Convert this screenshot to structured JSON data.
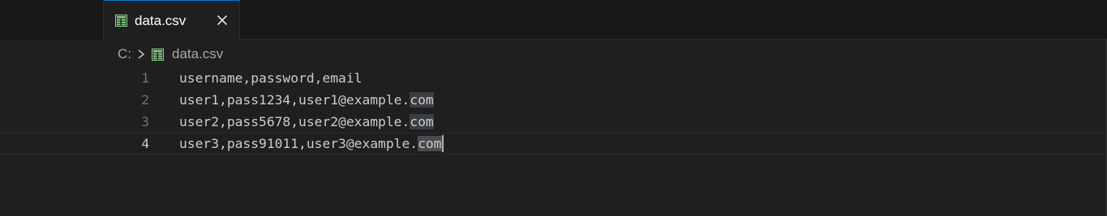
{
  "tab": {
    "label": "data.csv",
    "icon": "spreadsheet-icon",
    "close_icon": "close-icon"
  },
  "breadcrumb": {
    "drive": "C:",
    "separator_icon": "chevron-right-icon",
    "file": "data.csv"
  },
  "editor": {
    "lines": [
      {
        "number": "1",
        "text": "username,password,email",
        "match": ""
      },
      {
        "number": "2",
        "text": "user1,pass1234,user1@example.",
        "match": "com"
      },
      {
        "number": "3",
        "text": "user2,pass5678,user2@example.",
        "match": "com"
      },
      {
        "number": "4",
        "text": "user3,pass91011,user3@example.",
        "match": "com"
      }
    ],
    "current_line": "4"
  },
  "colors": {
    "accent": "#0078d4",
    "csv_icon": "#89d185",
    "background": "#1f1f1f"
  }
}
